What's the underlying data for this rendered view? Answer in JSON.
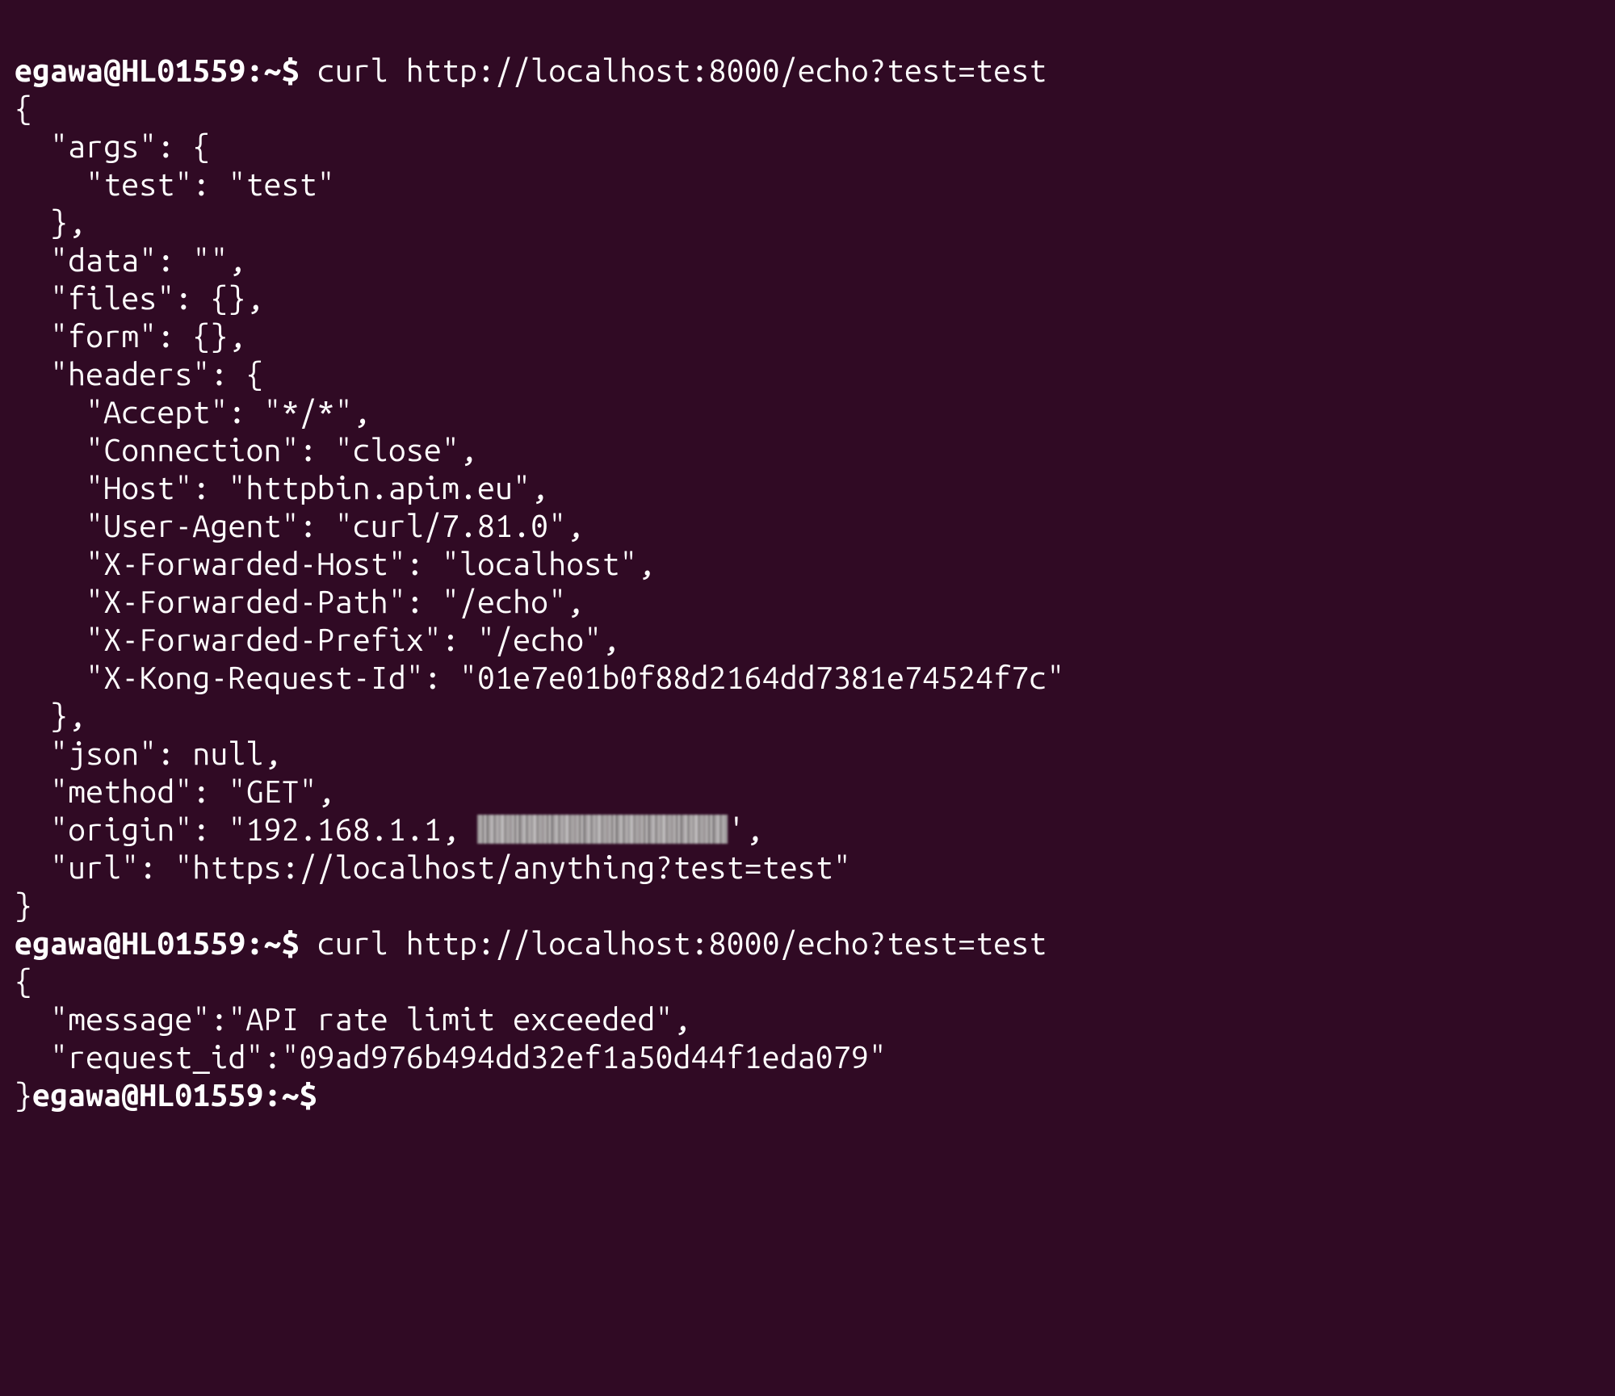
{
  "session": {
    "prompt1": "egawa@HL01559:~$ ",
    "cmd1": "curl http://localhost:8000/echo?test=test",
    "prompt2": "egawa@HL01559:~$ ",
    "cmd2": "curl http://localhost:8000/echo?test=test",
    "prompt3": "egawa@HL01559:~$"
  },
  "response1": {
    "l01": "{",
    "l02": "  \"args\": {",
    "l03": "    \"test\": \"test\"",
    "l04": "  },",
    "l05": "  \"data\": \"\",",
    "l06": "  \"files\": {},",
    "l07": "  \"form\": {},",
    "l08": "  \"headers\": {",
    "l09": "    \"Accept\": \"*/*\",",
    "l10": "    \"Connection\": \"close\",",
    "l11": "    \"Host\": \"httpbin.apim.eu\",",
    "l12": "    \"User-Agent\": \"curl/7.81.0\",",
    "l13": "    \"X-Forwarded-Host\": \"localhost\",",
    "l14": "    \"X-Forwarded-Path\": \"/echo\",",
    "l15": "    \"X-Forwarded-Prefix\": \"/echo\",",
    "l16": "    \"X-Kong-Request-Id\": \"01e7e01b0f88d2164dd7381e74524f7c\"",
    "l17": "  },",
    "l18": "  \"json\": null,",
    "l19": "  \"method\": \"GET\",",
    "origin_pre": "  \"origin\": \"192.168.1.1, ",
    "origin_post": "',",
    "l21": "  \"url\": \"https://localhost/anything?test=test\"",
    "l22": "}"
  },
  "response2": {
    "l01": "{",
    "l02": "  \"message\":\"API rate limit exceeded\",",
    "l03": "  \"request_id\":\"09ad976b494dd32ef1a50d44f1eda079\"",
    "l04": "}"
  }
}
